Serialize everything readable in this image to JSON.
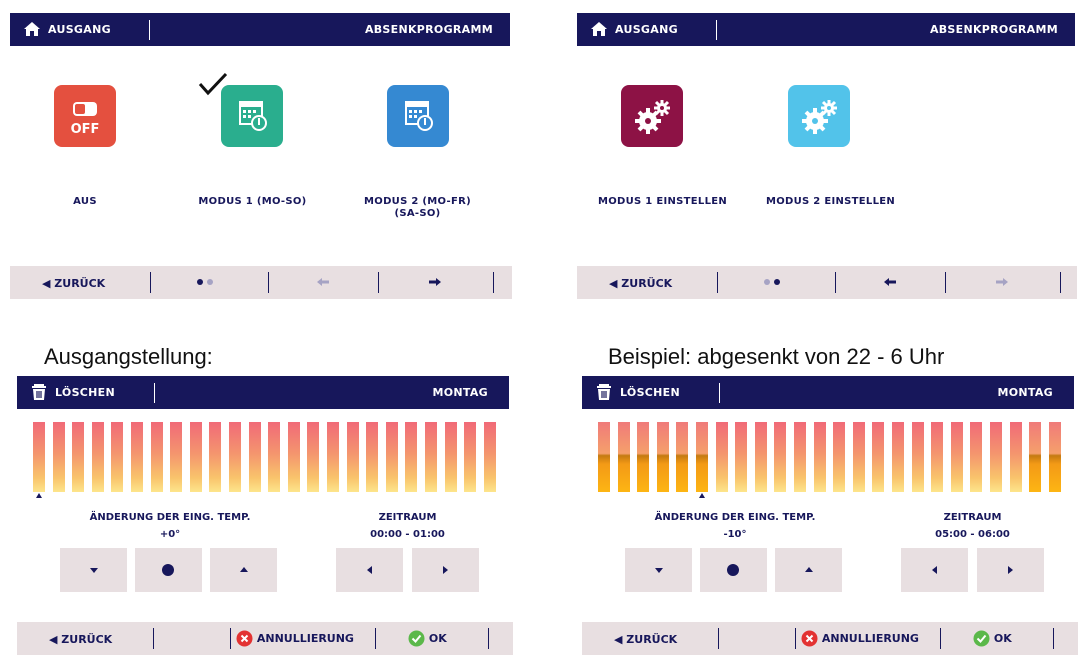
{
  "colors": {
    "navy": "#17175b",
    "barbg": "#e8dfe1",
    "off_red": "#e4503f",
    "mode1_green": "#2aae8e",
    "mode2_blue": "#3589d2",
    "set1_maroon": "#8d1245",
    "set2_sky": "#52c3ea"
  },
  "panel1": {
    "header": {
      "left": "AUSGANG",
      "right": "ABSENKPROGRAMM",
      "icon": "home-icon"
    },
    "tiles": [
      {
        "label": "AUS",
        "icon": "off-toggle-icon",
        "sublabel": "OFF"
      },
      {
        "label": "MODUS 1 (MO-SO)",
        "icon": "calendar-thermometer-icon",
        "selected": true
      },
      {
        "label": "MODUS 2 (MO-FR)",
        "label2": "(SA-SO)",
        "icon": "calendar-thermometer-icon"
      }
    ],
    "footer": {
      "back": "ZURÜCK",
      "page_dots": 2,
      "active_page": 1
    }
  },
  "panel2": {
    "header": {
      "left": "AUSGANG",
      "right": "ABSENKPROGRAMM",
      "icon": "home-icon"
    },
    "tiles": [
      {
        "label": "MODUS 1 EINSTELLEN",
        "icon": "gears-icon"
      },
      {
        "label": "MODUS 2 EINSTELLEN",
        "icon": "gears-icon"
      }
    ],
    "footer": {
      "back": "ZURÜCK",
      "page_dots": 2,
      "active_page": 2
    }
  },
  "captions": {
    "left": "Ausgangstellung:",
    "right": "Beispiel: abgesenkt von 22 - 6 Uhr"
  },
  "panel3": {
    "header": {
      "left": "LÖSCHEN",
      "right": "MONTAG",
      "icon": "trash-icon"
    },
    "temp_label": "ÄNDERUNG DER EING. TEMP.",
    "temp_value": "+0°",
    "period_label": "ZEITRAUM",
    "period_value": "00:00 - 01:00",
    "hours": [
      0,
      0,
      0,
      0,
      0,
      0,
      0,
      0,
      0,
      0,
      0,
      0,
      0,
      0,
      0,
      0,
      0,
      0,
      0,
      0,
      0,
      0,
      0,
      0
    ],
    "marker_hour": 0,
    "footer": {
      "back": "ZURÜCK",
      "cancel": "ANNULLIERUNG",
      "ok": "OK"
    }
  },
  "panel4": {
    "header": {
      "left": "LÖSCHEN",
      "right": "MONTAG",
      "icon": "trash-icon"
    },
    "temp_label": "ÄNDERUNG DER EING. TEMP.",
    "temp_value": "-10°",
    "period_label": "ZEITRAUM",
    "period_value": "05:00 - 06:00",
    "hours": [
      1,
      1,
      1,
      1,
      1,
      1,
      0,
      0,
      0,
      0,
      0,
      0,
      0,
      0,
      0,
      0,
      0,
      0,
      0,
      0,
      0,
      0,
      1,
      1
    ],
    "marker_hour": 5,
    "footer": {
      "back": "ZURÜCK",
      "cancel": "ANNULLIERUNG",
      "ok": "OK"
    }
  }
}
